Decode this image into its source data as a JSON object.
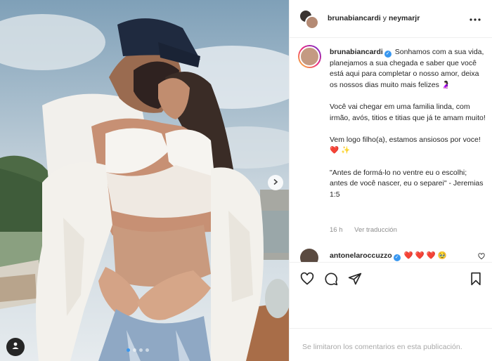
{
  "header": {
    "user1": "brunabiancardi",
    "connector": "y",
    "user2": "neymarjr"
  },
  "caption": {
    "username": "brunabiancardi",
    "p1": "Sonhamos com a sua vida, planejamos a sua chegada e saber que você está aqui para completar o nosso amor, deixa os nossos dias muito mais felizes 🤰🏻",
    "p2": "Você vai chegar em uma familia linda, com irmão, avós, titios e titias que já te amam muito!",
    "p3_text": "Vem logo filho(a), estamos ansiosos por voce!",
    "p3_emoji1": "❤️",
    "p3_emoji2": "✨",
    "p4": "\"Antes de formá-lo no ventre eu o escolhi; antes de você nascer, eu o separei\" - Jeremias 1:5",
    "time": "16 h",
    "translate": "Ver traducción"
  },
  "comment": {
    "username": "antonelaroccuzzo",
    "emojis": "❤️ ❤️ ❤️ 🥹"
  },
  "footer": {
    "text": "Se limitaron los comentarios en esta publicación."
  },
  "carousel": {
    "count": 4,
    "active": 1
  },
  "icons": [
    "heart-icon",
    "comment-icon",
    "share-icon",
    "bookmark-icon",
    "more-icon",
    "chevron-right-icon",
    "user-tag-icon"
  ],
  "colors": {
    "accent": "#3897f0",
    "muted": "#8e8e8e",
    "border": "#efefef"
  }
}
